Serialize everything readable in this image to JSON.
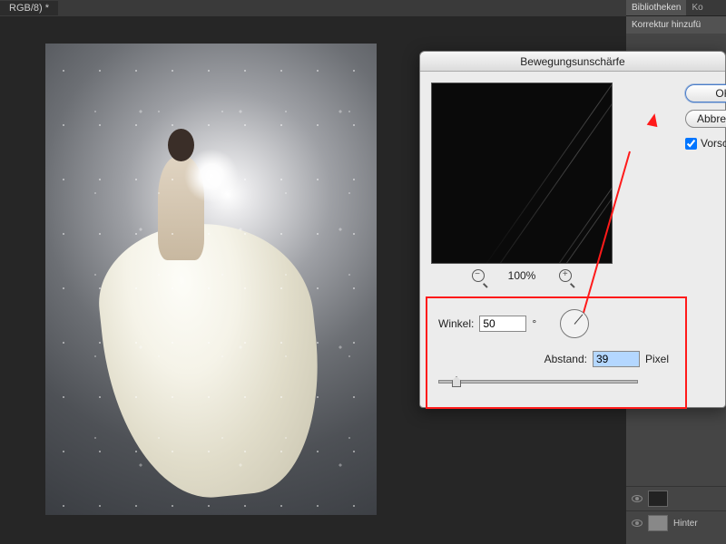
{
  "doc_tab": "RGB/8) *",
  "panels": {
    "tab_libraries": "Bibliotheken",
    "tab_other": "Ko",
    "adjustments_label": "Korrektur hinzufü"
  },
  "layers": {
    "item_bg": "Hinter"
  },
  "dialog": {
    "title": "Bewegungsunschärfe",
    "zoom_percent": "100%",
    "angle_label": "Winkel:",
    "angle_value": "50",
    "degree": "°",
    "distance_label": "Abstand:",
    "distance_value": "39",
    "distance_unit": "Pixel",
    "ok": "OK",
    "cancel": "Abbrechen",
    "preview": "Vorschau",
    "preview_checked": true
  }
}
